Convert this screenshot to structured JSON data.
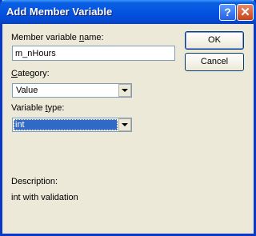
{
  "window": {
    "title": "Add Member Variable"
  },
  "titlebar": {
    "help_glyph": "?",
    "close_glyph": "✕"
  },
  "form": {
    "member_name_label_pre": "Member variable ",
    "member_name_label_ul": "n",
    "member_name_label_post": "ame:",
    "member_name_value": "m_nHours",
    "category_label_ul": "C",
    "category_label_post": "ategory:",
    "category_value": "Value",
    "vartype_label_pre": "Variable ",
    "vartype_label_ul": "t",
    "vartype_label_post": "ype:",
    "vartype_value": "int",
    "description_label": "Description:",
    "description_value": "int with validation"
  },
  "buttons": {
    "ok_label": "OK",
    "cancel_label": "Cancel"
  }
}
